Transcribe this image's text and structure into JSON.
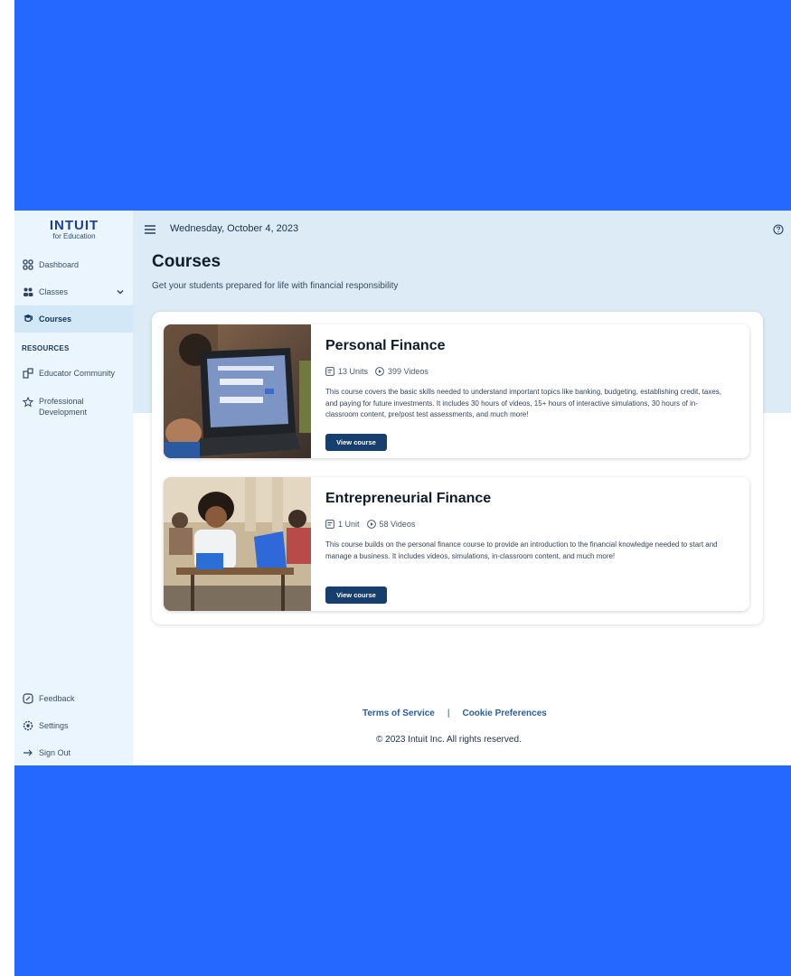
{
  "brand": {
    "name": "INTUIT",
    "subtitle": "for Education"
  },
  "topbar": {
    "date": "Wednesday, October 4, 2023"
  },
  "sidebar": {
    "items": [
      {
        "label": "Dashboard",
        "icon": "dashboard-grid-icon"
      },
      {
        "label": "Classes",
        "icon": "classes-icon"
      },
      {
        "label": "Courses",
        "icon": "courses-icon",
        "active": true
      }
    ],
    "resources_label": "RESOURCES",
    "resources": [
      {
        "label": "Educator Community",
        "icon": "community-icon"
      },
      {
        "label_line1": "Professional",
        "label_line2": "Development",
        "icon": "star-icon"
      }
    ],
    "bottom": [
      {
        "label": "Feedback",
        "icon": "feedback-icon"
      },
      {
        "label": "Settings",
        "icon": "settings-icon"
      },
      {
        "label": "Sign Out",
        "icon": "sign-out-arrow-icon"
      }
    ]
  },
  "page": {
    "title": "Courses",
    "subtitle": "Get your students prepared for life with financial responsibility"
  },
  "courses": [
    {
      "title": "Personal Finance",
      "units": "13 Units",
      "videos": "399 Videos",
      "description": "This course covers the basic skills needed to understand important topics like banking, budgeting, establishing credit, taxes, and paying for future investments. It includes 30 hours of videos, 15+ hours of interactive simulations, 30 hours of in-classroom content, pre/post test assessments, and much more!",
      "button": "View course"
    },
    {
      "title": "Entrepreneurial Finance",
      "units": "1 Unit",
      "videos": "58 Videos",
      "description": "This course builds on the personal finance course to provide an introduction to the financial knowledge needed to start and manage a business. It includes videos, simulations, in-classroom content, and much more!",
      "button": "View course"
    }
  ],
  "footer": {
    "terms": "Terms of Service",
    "separator": "|",
    "cookies": "Cookie Preferences",
    "copyright": "© 2023 Intuit Inc. All rights reserved."
  },
  "colors": {
    "frame_blue": "#2468ff",
    "sidebar_bg": "#eaf5fd",
    "hero_bg": "#dcebf6",
    "button_navy": "#163f6d"
  }
}
